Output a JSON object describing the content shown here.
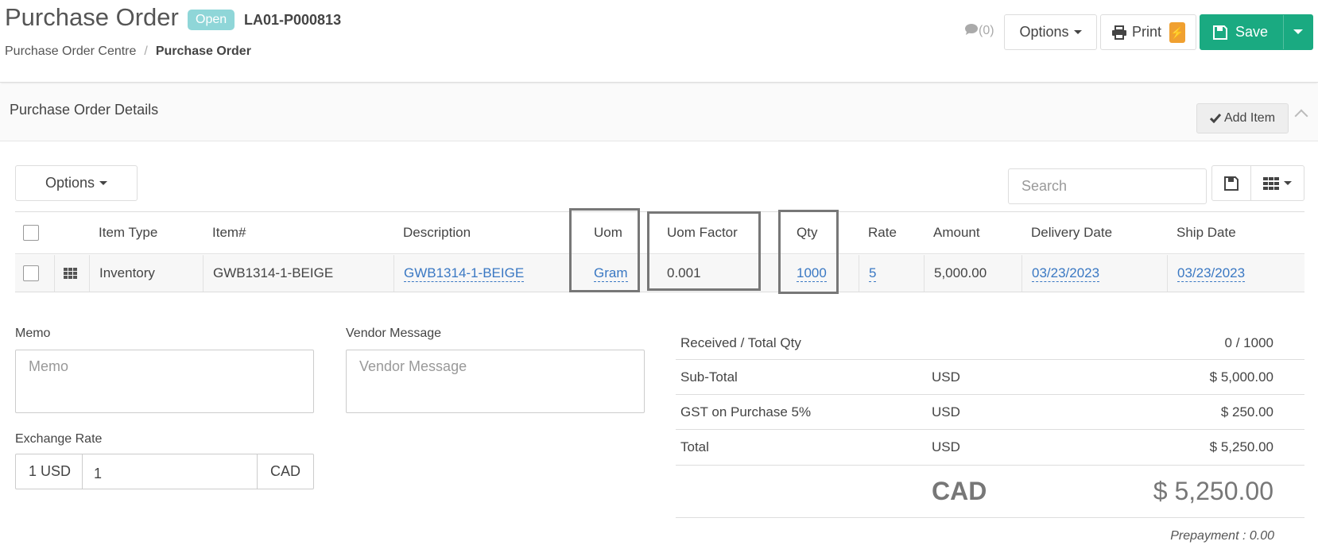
{
  "header": {
    "title": "Purchase Order",
    "status": "Open",
    "doc_number": "LA01-P000813",
    "breadcrumb": [
      "Purchase Order Centre",
      "Purchase Order"
    ],
    "comments_count": "(0)",
    "options_label": "Options",
    "print_label": "Print",
    "save_label": "Save"
  },
  "section": {
    "title": "Purchase Order Details",
    "add_item_label": "Add Item"
  },
  "toolbar": {
    "options_label": "Options",
    "search_placeholder": "Search"
  },
  "table": {
    "columns": [
      "Item Type",
      "Item#",
      "Description",
      "Uom",
      "Uom Factor",
      "Qty",
      "Rate",
      "Amount",
      "Delivery Date",
      "Ship Date"
    ],
    "rows": [
      {
        "item_type": "Inventory",
        "item_no": "GWB1314-1-BEIGE",
        "description": "GWB1314-1-BEIGE",
        "uom": "Gram",
        "uom_factor": "0.001",
        "qty": "1000",
        "rate": "5",
        "amount": "5,000.00",
        "delivery_date": "03/23/2023",
        "ship_date": "03/23/2023"
      }
    ]
  },
  "form": {
    "memo_label": "Memo",
    "memo_placeholder": "Memo",
    "vendor_message_label": "Vendor Message",
    "vendor_message_placeholder": "Vendor Message",
    "exchange_rate_label": "Exchange Rate",
    "exchange_from": "1 USD",
    "exchange_value": "1",
    "exchange_to": "CAD"
  },
  "summary": {
    "received_label": "Received / Total Qty",
    "received_value": "0 / 1000",
    "subtotal_label": "Sub-Total",
    "subtotal_currency": "USD",
    "subtotal_value": "$ 5,000.00",
    "tax_label": "GST on Purchase 5%",
    "tax_currency": "USD",
    "tax_value": "$ 250.00",
    "total_label": "Total",
    "total_currency": "USD",
    "total_value": "$ 5,250.00",
    "grand_currency": "CAD",
    "grand_value": "$ 5,250.00",
    "prepayment": "Prepayment : 0.00"
  },
  "colors": {
    "accent_green": "#1aaa81",
    "status_teal": "#8fd6d8",
    "link_blue": "#3a78c3",
    "print_orange": "#f0a030"
  }
}
